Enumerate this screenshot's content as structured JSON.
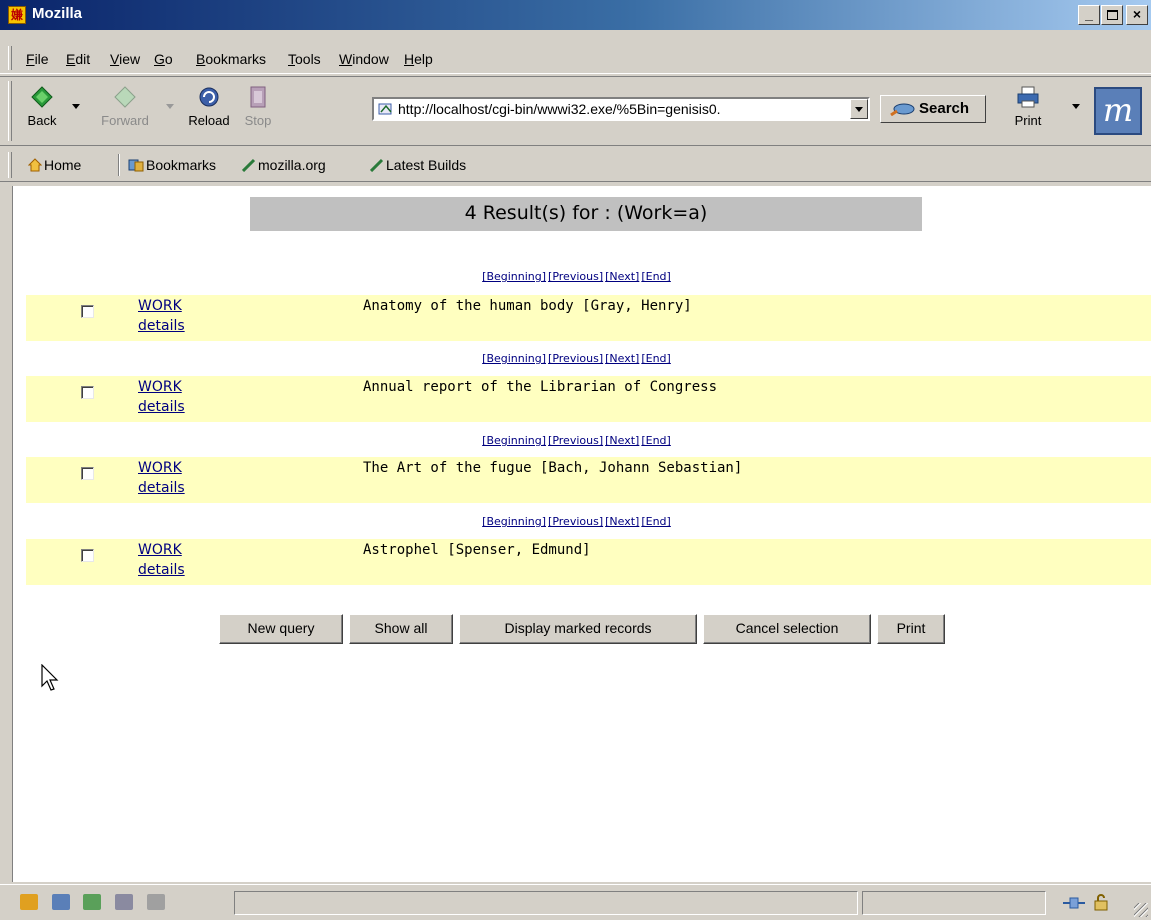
{
  "window": {
    "title": "Mozilla"
  },
  "menu": [
    "File",
    "Edit",
    "View",
    "Go",
    "Bookmarks",
    "Tools",
    "Window",
    "Help"
  ],
  "nav": {
    "back": "Back",
    "forward": "Forward",
    "reload": "Reload",
    "stop": "Stop",
    "url": "http://localhost/cgi-bin/wwwi32.exe/%5Bin=genisis0.",
    "search": "Search",
    "print": "Print"
  },
  "personal_toolbar": [
    "Home",
    "Bookmarks",
    "mozilla.org",
    "Latest Builds"
  ],
  "results": {
    "heading": "4 Result(s) for : (Work=a)",
    "pager": [
      "[Beginning]",
      "[Previous]",
      "[Next]",
      "[End]"
    ],
    "records": [
      {
        "type_link": "WORK",
        "details_link": "details",
        "title": "Anatomy of the human body [Gray, Henry]"
      },
      {
        "type_link": "WORK",
        "details_link": "details",
        "title": "Annual report of the Librarian of Congress"
      },
      {
        "type_link": "WORK",
        "details_link": "details",
        "title": "The Art of the fugue [Bach, Johann Sebastian]"
      },
      {
        "type_link": "WORK",
        "details_link": "details",
        "title": "Astrophel [Spenser, Edmund]"
      }
    ],
    "buttons": [
      "New query",
      "Show all",
      "Display marked records",
      "Cancel selection",
      "Print"
    ]
  },
  "colors": {
    "row_highlight": "#ffffc0",
    "title_bar": "#0a246a",
    "link": "#000080"
  }
}
